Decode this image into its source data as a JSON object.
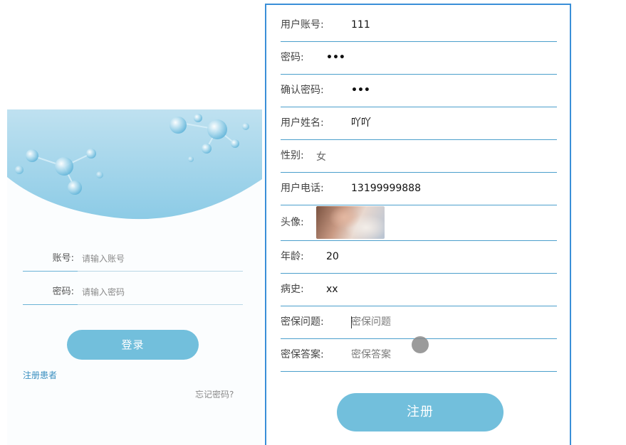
{
  "login": {
    "account_label": "账号:",
    "account_placeholder": "请输入账号",
    "password_label": "密码:",
    "password_placeholder": "请输入密码",
    "login_button": "登录",
    "register_link": "注册患者",
    "forgot_link": "忘记密码?"
  },
  "register": {
    "fields": [
      {
        "label": "用户账号:",
        "value": "111"
      },
      {
        "label": "密码:",
        "value": "•••"
      },
      {
        "label": "确认密码:",
        "value": "•••"
      },
      {
        "label": "用户姓名:",
        "value": "吖吖"
      },
      {
        "label": "性别:",
        "value": "女"
      },
      {
        "label": "用户电话:",
        "value": "13199999888"
      },
      {
        "label": "头像:",
        "value": ""
      },
      {
        "label": "年龄:",
        "value": "20"
      },
      {
        "label": "病史:",
        "value": "xx"
      },
      {
        "label": "密保问题:",
        "value": "",
        "placeholder": "密保问题"
      },
      {
        "label": "密保答案:",
        "value": "",
        "placeholder": "密保答案"
      }
    ],
    "submit_button": "注册"
  },
  "colors": {
    "accent": "#72bfdc",
    "panel_border": "#3a8fd8",
    "row_divider": "#4b9fcc"
  }
}
